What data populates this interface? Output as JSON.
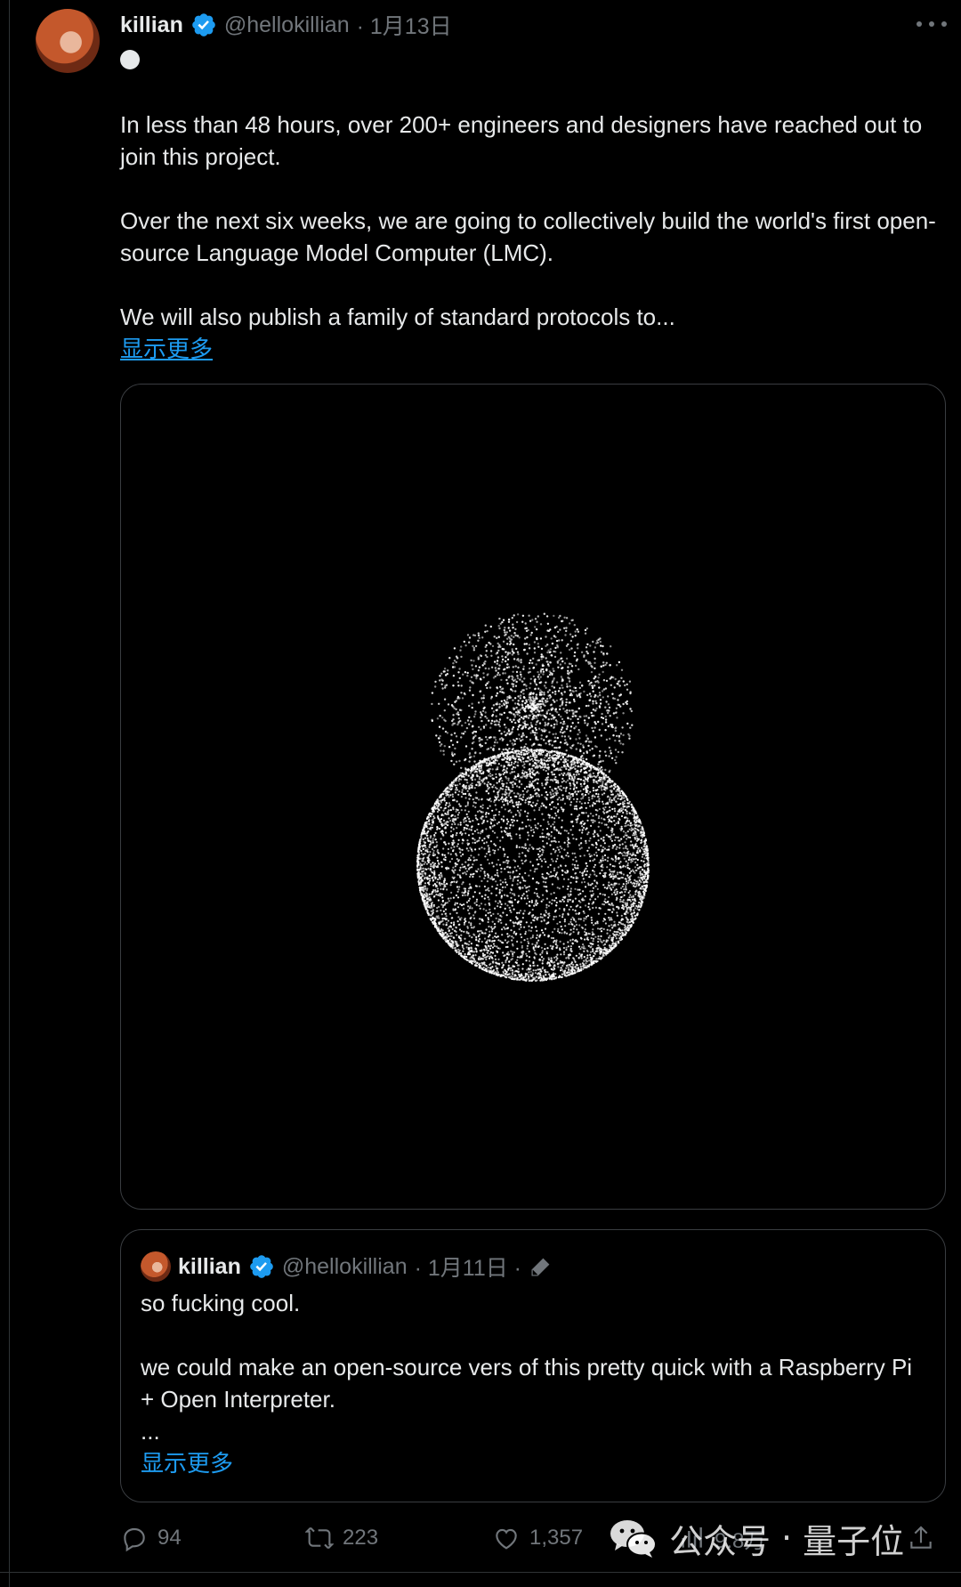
{
  "tweet": {
    "author_name": "killian",
    "handle": "@hellokillian",
    "date": "· 1月13日",
    "paragraphs": [
      "In less than 48 hours, over 200+ engineers and designers have reached out to join this project.",
      "Over the next six weeks, we are going to collectively build the world's first open-source Language Model Computer (LMC).",
      "We will also publish a family of standard protocols to..."
    ],
    "show_more": "显示更多"
  },
  "quote": {
    "author_name": "killian",
    "handle": "@hellokillian",
    "date": "· 1月11日 ·",
    "paragraphs": [
      "so fucking cool.",
      "we could make an open-source vers of this pretty quick with a Raspberry Pi + Open Interpreter."
    ],
    "ellipsis": "...",
    "show_more": "显示更多"
  },
  "actions": {
    "replies": "94",
    "reposts": "223",
    "likes": "1,357",
    "views": "9.8万"
  },
  "watermark": {
    "account": "公众号",
    "separator": "·",
    "name": "量子位"
  },
  "icons": {
    "verified": "verified-badge-icon",
    "more": "more-horizontal-icon",
    "reply": "reply-icon",
    "repost": "repost-icon",
    "like": "like-icon",
    "views": "views-icon",
    "share": "share-icon",
    "edit": "edit-pencil-icon",
    "wechat": "wechat-logo-icon"
  },
  "colors": {
    "background": "#000000",
    "text": "#e7e9ea",
    "muted": "#71767b",
    "link": "#1d9bf0",
    "verified": "#1d9bf0",
    "border": "#2f3336"
  }
}
